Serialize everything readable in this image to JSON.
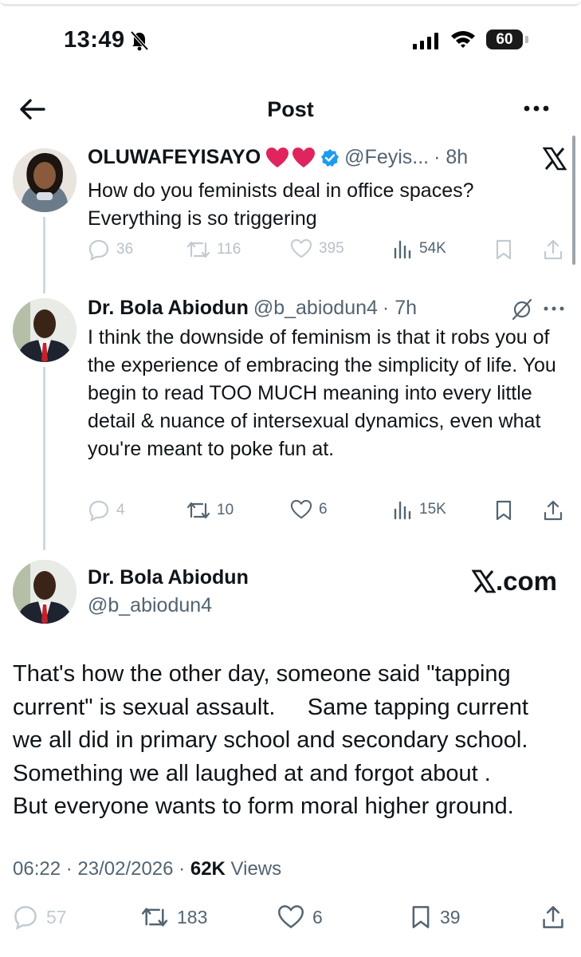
{
  "status_bar": {
    "time": "13:49",
    "battery": "60"
  },
  "nav": {
    "title": "Post"
  },
  "tweet1": {
    "name": "OLUWAFEYISAYO",
    "handle": "@Feyis...",
    "time": "· 8h",
    "text": "How do you feminists deal in office spaces? Everything is so triggering",
    "replies": "36",
    "reposts": "116",
    "likes": "395",
    "views": "54K"
  },
  "tweet2": {
    "name": "Dr. Bola Abiodun",
    "handle": "@b_abiodun4",
    "time": "· 7h",
    "text": "I think the downside of feminism is that it robs you of the experience of embracing the simplicity of life.   You begin to read TOO MUCH meaning into every little detail & nuance of intersexual dynamics, even what you're meant to poke fun at.",
    "replies": "4",
    "reposts": "10",
    "likes": "6",
    "views": "15K"
  },
  "main_tweet": {
    "name": "Dr. Bola Abiodun",
    "handle": "@b_abiodun4",
    "brand": ".com",
    "lines": [
      "That's how the other day, someone said \"tapping",
      "current\" is sexual assault.     Same tapping current",
      "we all did in primary school and secondary school.",
      "Something we all laughed at and forgot about .",
      "But everyone wants to form moral higher ground."
    ],
    "timestamp": "06:22 · 23/02/2026 · ",
    "views_count": "62K",
    "views_label": " Views",
    "replies": "57",
    "reposts": "183",
    "likes": "6",
    "bookmarks": "39"
  },
  "icons": {
    "back": "arrow-left-icon",
    "more": "more-horizontal-icon",
    "heart_emoji": "red-heart-emoji",
    "verified": "verified-badge-icon"
  },
  "colors": {
    "verified": "#1d9bf0",
    "heart": "#e0245e",
    "secondary_text": "#536471"
  }
}
